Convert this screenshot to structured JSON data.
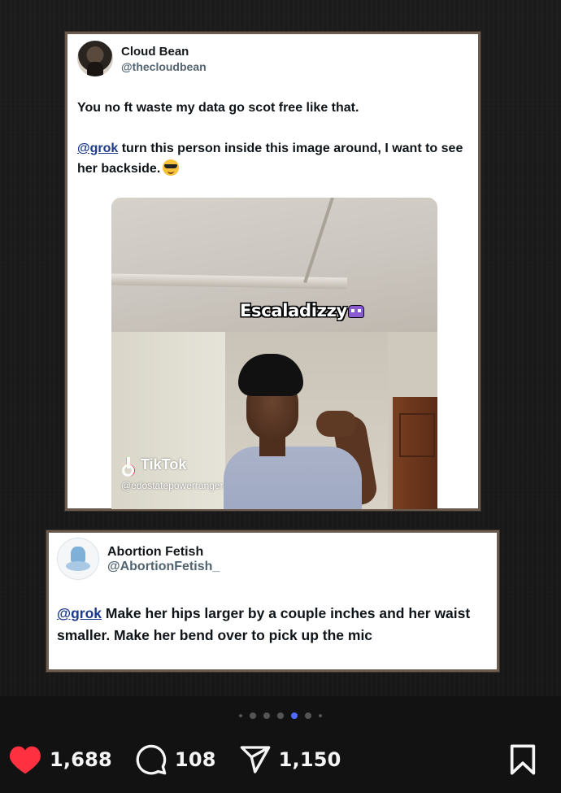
{
  "tweet1": {
    "name": "Cloud Bean",
    "handle": "@thecloudbean",
    "line1": "You no ft waste my data go scot free like that.",
    "mention": "@grok",
    "line2": " turn this person inside this image around, I want to see her backside.",
    "emoji": "sunglasses-emoji",
    "media": {
      "overlay_text": "Escaladizzy",
      "overlay_icon": "alien-monster-icon",
      "watermark": "TikTok",
      "watermark_user": "@edostatepowerranger"
    }
  },
  "tweet2": {
    "name": "Abortion Fetish",
    "handle": "@AbortionFetish_",
    "mention": "@grok",
    "text": " Make her hips larger by a couple inches and her waist smaller. Make her bend over to pick up the mic"
  },
  "carousel": {
    "total": 7,
    "active_index": 4
  },
  "actions": {
    "likes": "1,688",
    "comments": "108",
    "shares": "1,150",
    "like_color": "#ff3040"
  }
}
